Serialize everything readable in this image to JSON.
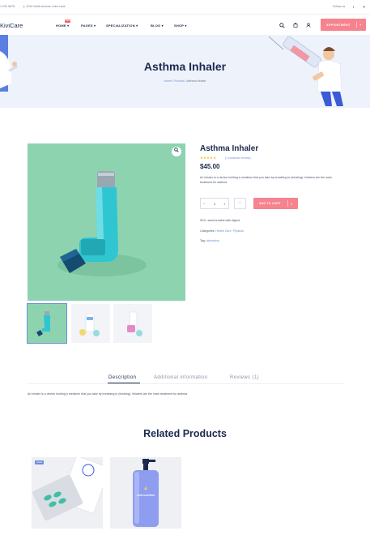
{
  "topbar": {
    "phone": "1 234 5678",
    "address": "1234 North Avenue Luke Lane",
    "follow_label": "Follow us",
    "social_icons": [
      "facebook-icon",
      "twitter-icon"
    ]
  },
  "header": {
    "logo": "KiviCare",
    "nav": [
      {
        "label": "HOME",
        "badge": "NEW"
      },
      {
        "label": "PAGES"
      },
      {
        "label": "SPECIALIZATION"
      },
      {
        "label": "BLOG"
      },
      {
        "label": "SHOP"
      }
    ],
    "icons": [
      "search-icon",
      "cart-icon",
      "user-icon"
    ],
    "appointment_label": "APPOINTMENT",
    "appointment_icon": "+"
  },
  "banner": {
    "title": "Asthma Inhaler",
    "breadcrumb": [
      "Home",
      "Product",
      "Asthma Inhaler"
    ],
    "separator": "/"
  },
  "product": {
    "title": "Asthma Inhaler",
    "rating": "★★★★★",
    "reviews_link": "(1 customer review)",
    "price": "$45.00",
    "description": "An inhaler is a device holding a medicine that you take by breathing in (inhaling). Inhalers are the main treatment for asthma.",
    "quantity": "1",
    "qty_minus": "−",
    "qty_plus": "+",
    "add_to_cart": "ADD TO CART",
    "sku_label": "SKU:",
    "sku": "asmt-breathe-with-digest",
    "categories_label": "Categories:",
    "categories": "Health Care, Physical",
    "tag_label": "Tag:",
    "tag": "laboratory"
  },
  "tabs": [
    {
      "label": "Description",
      "active": true
    },
    {
      "label": "Additional information",
      "active": false
    },
    {
      "label": "Reviews (1)",
      "active": false
    }
  ],
  "tab_content": "An inhaler is a device holding a medicine that you take by breathing in (inhaling). Inhalers are the main treatment for asthma.",
  "related": {
    "title": "Related Products",
    "items": [
      {
        "badge": "SALE",
        "image": "pill-box-image"
      },
      {
        "badge": "",
        "image": "hand-sanitizer-image",
        "image_text": "HAND SANITIZER"
      }
    ]
  },
  "colors": {
    "accent": "#f6838e",
    "link": "#6e8fd6",
    "heading": "#1d2a4d",
    "banner_bg": "#eef2fb",
    "product_bg": "#8ed3b0"
  }
}
